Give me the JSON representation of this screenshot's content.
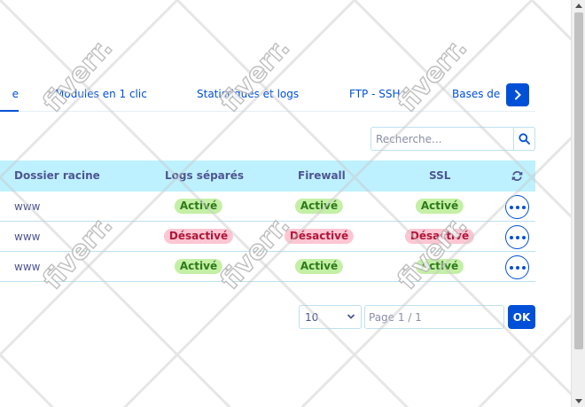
{
  "tabs": {
    "active_fragment": "e",
    "items": [
      {
        "label": "Modules en 1 clic"
      },
      {
        "label": "Statistiques et logs"
      },
      {
        "label": "FTP - SSH"
      },
      {
        "label": "Bases de"
      }
    ],
    "next_icon": "chevron-right-icon"
  },
  "search": {
    "placeholder": "Recherche...",
    "value": "",
    "icon": "search-icon"
  },
  "table": {
    "columns": [
      "Dossier racine",
      "Logs séparés",
      "Firewall",
      "SSL"
    ],
    "refresh_icon": "refresh-icon",
    "rows": [
      {
        "folder": "www",
        "logs": "Activé",
        "firewall": "Activé",
        "ssl": "Activé"
      },
      {
        "folder": "www",
        "logs": "Désactivé",
        "firewall": "Désactivé",
        "ssl": "Désactivé"
      },
      {
        "folder": "www",
        "logs": "Activé",
        "firewall": "Activé",
        "ssl": "Activé"
      }
    ],
    "row_action_icon": "more-options-icon"
  },
  "pagination": {
    "page_size": "10",
    "page_label": "Page 1 / 1",
    "ok_label": "OK"
  },
  "watermark": {
    "text": "fiverr."
  },
  "colors": {
    "accent": "#0050d7",
    "header_bg": "#bef1ff",
    "badge_on_bg": "#c4f0a6",
    "badge_on_text": "#2e7a19",
    "badge_off_bg": "#fdc6d2",
    "badge_off_text": "#b0163a",
    "text": "#4d5592"
  }
}
